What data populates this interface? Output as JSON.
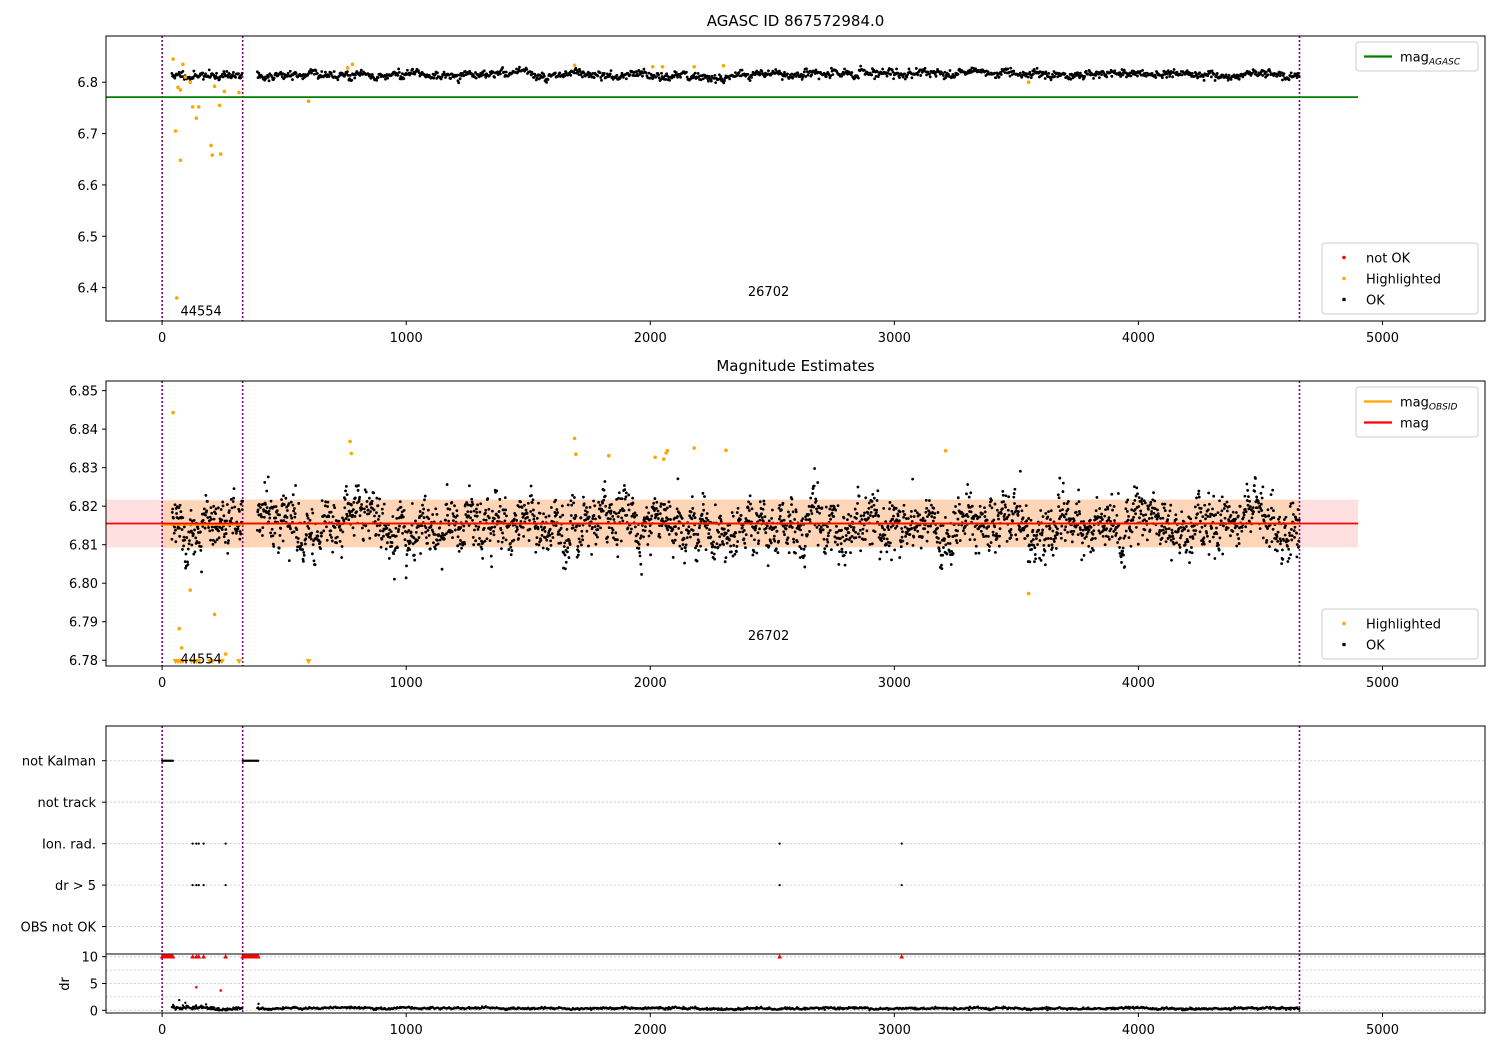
{
  "chart_data": [
    {
      "type": "scatter",
      "title": "AGASC ID 867572984.0",
      "xlabel": "",
      "ylabel": "",
      "xlim": [
        -230,
        5420
      ],
      "ylim": [
        6.335,
        6.89
      ],
      "xticks": [
        0,
        1000,
        2000,
        3000,
        4000,
        5000
      ],
      "xtick_labels": [
        "0",
        "1000",
        "2000",
        "3000",
        "4000",
        "5000"
      ],
      "yticks": [
        6.4,
        6.5,
        6.6,
        6.7,
        6.8
      ],
      "ytick_labels": [
        "6.4",
        "6.5",
        "6.6",
        "6.7",
        "6.8"
      ],
      "grid": false,
      "vlines": [
        0,
        330,
        4660
      ],
      "hline": {
        "y": 6.771,
        "x_range": [
          -230,
          4900
        ],
        "name": "mag",
        "name_sub": "AGASC",
        "color": "#008000"
      },
      "annotations": [
        {
          "text": "44554",
          "x": 75,
          "y": 6.355
        },
        {
          "text": "26702",
          "x": 2400,
          "y": 6.393
        }
      ],
      "series": [
        {
          "name": "not OK",
          "color": "#ff0000",
          "points": []
        },
        {
          "name": "Highlighted",
          "color": "#ffa500",
          "points": [
            [
              45,
              6.845
            ],
            [
              55,
              6.705
            ],
            [
              60,
              6.38
            ],
            [
              65,
              6.79
            ],
            [
              75,
              6.785
            ],
            [
              75,
              6.648
            ],
            [
              85,
              6.835
            ],
            [
              95,
              6.81
            ],
            [
              115,
              6.8
            ],
            [
              125,
              6.752
            ],
            [
              140,
              6.73
            ],
            [
              150,
              6.752
            ],
            [
              200,
              6.677
            ],
            [
              205,
              6.658
            ],
            [
              215,
              6.792
            ],
            [
              235,
              6.755
            ],
            [
              240,
              6.66
            ],
            [
              255,
              6.782
            ],
            [
              315,
              6.78
            ],
            [
              600,
              6.763
            ],
            [
              760,
              6.828
            ],
            [
              780,
              6.835
            ],
            [
              1690,
              6.833
            ],
            [
              2010,
              6.83
            ],
            [
              2050,
              6.83
            ],
            [
              2180,
              6.83
            ],
            [
              2300,
              6.832
            ],
            [
              3550,
              6.8
            ]
          ]
        },
        {
          "name": "OK",
          "color": "#000000",
          "segments": [
            {
              "x0": 40,
              "x1": 330,
              "center": 6.813,
              "noise": 0.008
            },
            {
              "x0": 390,
              "x1": 4660,
              "center": 6.815,
              "noise": 0.008
            }
          ]
        }
      ],
      "legends": [
        {
          "placement": "top-right",
          "entries": [
            {
              "label": "mag",
              "sub": "AGASC",
              "color": "#008000",
              "kind": "line"
            }
          ]
        },
        {
          "placement": "bottom-right",
          "entries": [
            {
              "label": "not OK",
              "color": "#ff0000",
              "kind": "dot"
            },
            {
              "label": "Highlighted",
              "color": "#ffa500",
              "kind": "dot"
            },
            {
              "label": "OK",
              "color": "#000000",
              "kind": "dot"
            }
          ]
        }
      ]
    },
    {
      "type": "scatter",
      "title": "Magnitude Estimates",
      "xlabel": "",
      "ylabel": "",
      "xlim": [
        -230,
        5420
      ],
      "ylim": [
        6.7785,
        6.8525
      ],
      "xticks": [
        0,
        1000,
        2000,
        3000,
        4000,
        5000
      ],
      "xtick_labels": [
        "0",
        "1000",
        "2000",
        "3000",
        "4000",
        "5000"
      ],
      "yticks": [
        6.78,
        6.79,
        6.8,
        6.81,
        6.82,
        6.83,
        6.84,
        6.85
      ],
      "ytick_labels": [
        "6.78",
        "6.79",
        "6.80",
        "6.81",
        "6.82",
        "6.83",
        "6.84",
        "6.85"
      ],
      "grid": false,
      "vlines": [
        0,
        330,
        4660
      ],
      "mag": {
        "value": 6.8155,
        "band": [
          6.8093,
          6.8217
        ],
        "x_range": [
          -230,
          4900
        ],
        "color": "#ff0000",
        "band_color": "#ffcccc"
      },
      "mag_obsid": [
        {
          "x0": 0,
          "x1": 330,
          "value": 6.8152,
          "band": [
            6.809,
            6.8214
          ]
        },
        {
          "x0": 330,
          "x1": 4660,
          "value": 6.8155,
          "band": [
            6.8093,
            6.8217
          ]
        }
      ],
      "annotations": [
        {
          "text": "44554",
          "x": 75,
          "y": 6.7805
        },
        {
          "text": "26702",
          "x": 2400,
          "y": 6.7865
        }
      ],
      "series": [
        {
          "name": "Highlighted",
          "color": "#ffa500",
          "points": [
            [
              45,
              6.8443
            ],
            [
              70,
              6.7882
            ],
            [
              80,
              6.7832
            ],
            [
              115,
              6.7982
            ],
            [
              215,
              6.7919
            ],
            [
              260,
              6.7816
            ],
            [
              770,
              6.8368
            ],
            [
              775,
              6.8337
            ],
            [
              1690,
              6.8376
            ],
            [
              1695,
              6.8335
            ],
            [
              1830,
              6.8331
            ],
            [
              2020,
              6.8327
            ],
            [
              2055,
              6.8322
            ],
            [
              2065,
              6.8338
            ],
            [
              2070,
              6.8344
            ],
            [
              2180,
              6.8351
            ],
            [
              2310,
              6.8345
            ],
            [
              3210,
              6.8344
            ],
            [
              3550,
              6.7973
            ]
          ]
        },
        {
          "name": "OK",
          "color": "#000000",
          "segments": [
            {
              "x0": 40,
              "x1": 330,
              "center": 6.8155,
              "noise": 0.0065
            },
            {
              "x0": 390,
              "x1": 4660,
              "center": 6.8155,
              "noise": 0.0065
            }
          ]
        }
      ],
      "lower_limit_markers": {
        "color": "#ffa500",
        "y": 6.7795,
        "x": [
          55,
          65,
          75,
          85,
          120,
          130,
          140,
          150,
          195,
          205,
          235,
          245,
          315,
          600
        ]
      },
      "legends": [
        {
          "placement": "top-right",
          "entries": [
            {
              "label": "mag",
              "sub": "OBSID",
              "color": "#ffa500",
              "kind": "line"
            },
            {
              "label": "mag",
              "color": "#ff0000",
              "kind": "line"
            }
          ]
        },
        {
          "placement": "bottom-right",
          "entries": [
            {
              "label": "Highlighted",
              "color": "#ffa500",
              "kind": "dot"
            },
            {
              "label": "OK",
              "color": "#000000",
              "kind": "dot"
            }
          ]
        }
      ]
    },
    {
      "type": "scatter",
      "title": "",
      "xlabel": "",
      "ylabel": "",
      "xlim": [
        -230,
        5420
      ],
      "xticks": [
        0,
        1000,
        2000,
        3000,
        4000,
        5000
      ],
      "xtick_labels": [
        "0",
        "1000",
        "2000",
        "3000",
        "4000",
        "5000"
      ],
      "grid": true,
      "vlines": [
        0,
        330,
        4660
      ],
      "categories": [
        "not Kalman",
        "not track",
        "Ion. rad.",
        "dr > 5",
        "OBS not OK"
      ],
      "flags": {
        "not Kalman": {
          "ranges": [
            [
              0,
              45
            ],
            [
              330,
              395
            ]
          ]
        },
        "not track": {
          "points": []
        },
        "Ion. rad.": {
          "points": [
            125,
            140,
            150,
            170,
            260,
            2530,
            3030
          ]
        },
        "dr > 5": {
          "points": [
            125,
            140,
            150,
            170,
            260,
            2530,
            3030
          ]
        },
        "OBS not OK": {
          "points": []
        }
      }
    },
    {
      "type": "scatter",
      "title": "",
      "xlabel": "",
      "ylabel": "dr",
      "xlim": [
        -230,
        5420
      ],
      "ylim": [
        -0.5,
        10.5
      ],
      "xticks": [
        0,
        1000,
        2000,
        3000,
        4000,
        5000
      ],
      "xtick_labels": [
        "0",
        "1000",
        "2000",
        "3000",
        "4000",
        "5000"
      ],
      "yticks": [
        0,
        5,
        10
      ],
      "ytick_labels": [
        "0",
        "5",
        "10"
      ],
      "grid": true,
      "vlines": [
        0,
        330,
        4660
      ],
      "clipped": {
        "color": "#ff0000",
        "y": 10,
        "ranges": [
          [
            0,
            45
          ],
          [
            330,
            395
          ]
        ],
        "points": [
          125,
          140,
          150,
          170,
          260,
          2530,
          3030
        ]
      },
      "outliers": {
        "color": "#ff0000",
        "points": [
          [
            140,
            4.3
          ],
          [
            240,
            3.7
          ]
        ]
      },
      "black_points": [
        [
          45,
          1.0
        ],
        [
          60,
          0.6
        ],
        [
          70,
          1.9
        ],
        [
          85,
          0.9
        ],
        [
          95,
          1.4
        ],
        [
          105,
          0.8
        ],
        [
          115,
          0.4
        ],
        [
          160,
          0.7
        ],
        [
          180,
          1.1
        ],
        [
          200,
          0.6
        ],
        [
          300,
          0.4
        ],
        [
          395,
          1.2
        ]
      ],
      "segments": [
        {
          "x0": 40,
          "x1": 330,
          "center": 0.35,
          "noise": 0.35
        },
        {
          "x0": 390,
          "x1": 4660,
          "center": 0.35,
          "noise": 0.2
        }
      ]
    }
  ]
}
